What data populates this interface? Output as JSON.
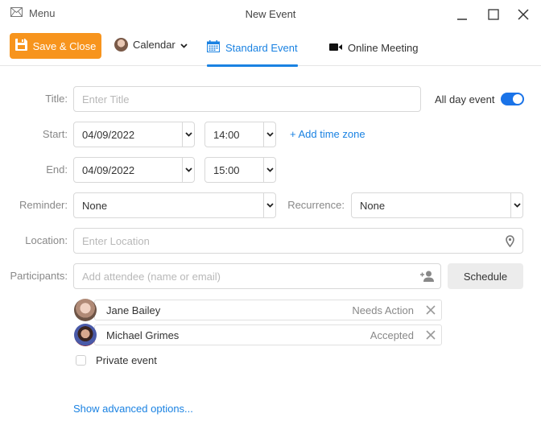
{
  "window": {
    "menu_label": "Menu",
    "title": "New Event"
  },
  "toolbar": {
    "save_label": "Save & Close",
    "calendar_label": "Calendar",
    "tabs": [
      {
        "label": "Standard Event",
        "icon": "calendar-icon",
        "active": true
      },
      {
        "label": "Online Meeting",
        "icon": "video-camera-icon",
        "active": false
      }
    ],
    "accent_color": "#f7941d",
    "active_tab_color": "#1a82e2"
  },
  "form": {
    "title": {
      "label": "Title:",
      "value": "",
      "placeholder": "Enter Title"
    },
    "all_day": {
      "label": "All day event",
      "enabled": true
    },
    "start": {
      "label": "Start:",
      "date": "04/09/2022",
      "time": "14:00"
    },
    "add_time_zone": "+ Add time zone",
    "end": {
      "label": "End:",
      "date": "04/09/2022",
      "time": "15:00"
    },
    "reminder": {
      "label": "Reminder:",
      "value": "None"
    },
    "recurrence": {
      "label": "Recurrence:",
      "value": "None"
    },
    "location": {
      "label": "Location:",
      "value": "",
      "placeholder": "Enter Location"
    },
    "participants": {
      "label": "Participants:",
      "value": "",
      "placeholder": "Add attendee (name or email)"
    },
    "schedule_label": "Schedule",
    "attendees": [
      {
        "name": "Jane Bailey",
        "status": "Needs Action"
      },
      {
        "name": "Michael Grimes",
        "status": "Accepted"
      }
    ],
    "private_event": {
      "label": "Private event",
      "checked": false
    },
    "advanced_link": "Show advanced options..."
  }
}
